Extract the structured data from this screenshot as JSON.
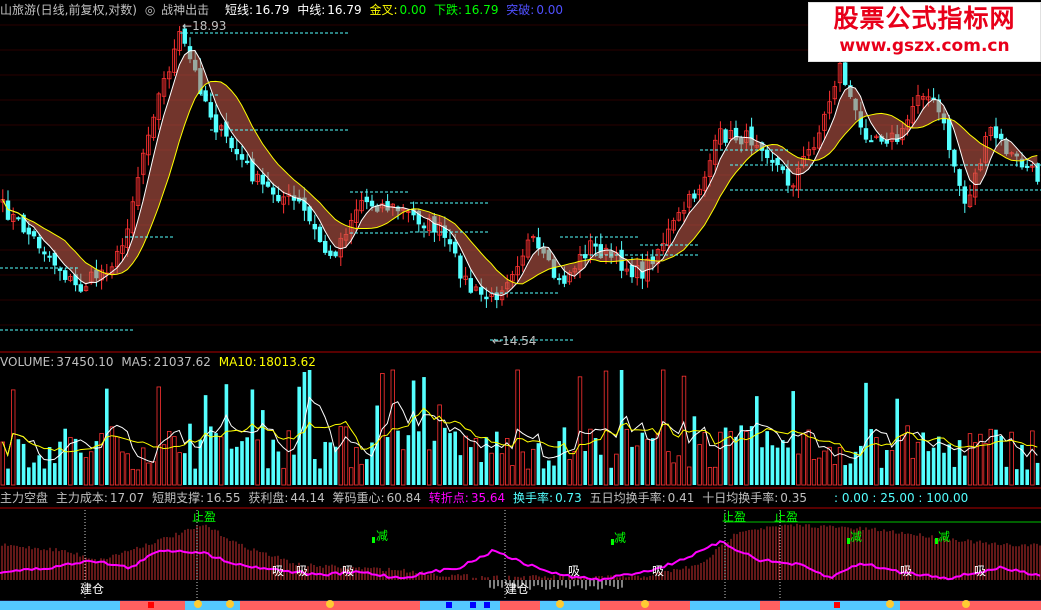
{
  "header": {
    "stock_name": "山旅游(日线,前复权,对数)",
    "indicator": "战神出击",
    "short_label": "短线:",
    "short_value": "16.79",
    "mid_label": "中线:",
    "mid_value": "16.79",
    "golden_label": "金叉:",
    "golden_value": "0.00",
    "fall_label": "下跌:",
    "fall_value": "16.79",
    "break_label": "突破:",
    "break_value": "0.00"
  },
  "price_marks": {
    "high": "18.93",
    "low": "14.54"
  },
  "volume_header": {
    "volume_label": "VOLUME:",
    "volume_value": "37450.10",
    "ma5_label": "MA5:",
    "ma5_value": "21037.62",
    "ma10_label": "MA10:",
    "ma10_value": "18013.62"
  },
  "indicator_header": {
    "name": "主力空盘",
    "cost_label": "主力成本:",
    "cost_value": "17.07",
    "support_label": "短期支撑:",
    "support_value": "16.55",
    "profit_label": "获利盘:",
    "profit_value": "44.14",
    "chip_label": "筹码重心:",
    "chip_value": "60.84",
    "turn_label": "转折点:",
    "turn_value": "35.64",
    "turnover_label": "换手率:",
    "turnover_value": "0.73",
    "avg5_label": "五日均换手率:",
    "avg5_value": "0.41",
    "avg10_label": "十日均换手率:",
    "avg10_value": "0.35",
    "range_text": ": 0.00 : 25.00 : 100.00"
  },
  "signals": {
    "take_profit": "止盈",
    "reduce": "减",
    "absorb": "吸",
    "build": "建仓"
  },
  "watermark": {
    "line1": "股票公式指标网",
    "line2": "www.gszx.com.cn"
  },
  "colors": {
    "up": "#ff3232",
    "down": "#54ffff",
    "ma_white": "#ffffff",
    "ma_yellow": "#ffff00",
    "ribbon": "#d06050",
    "dash": "#54ffff",
    "magenta": "#ff00ff",
    "green": "#00ff00",
    "separator": "#b00000"
  }
}
